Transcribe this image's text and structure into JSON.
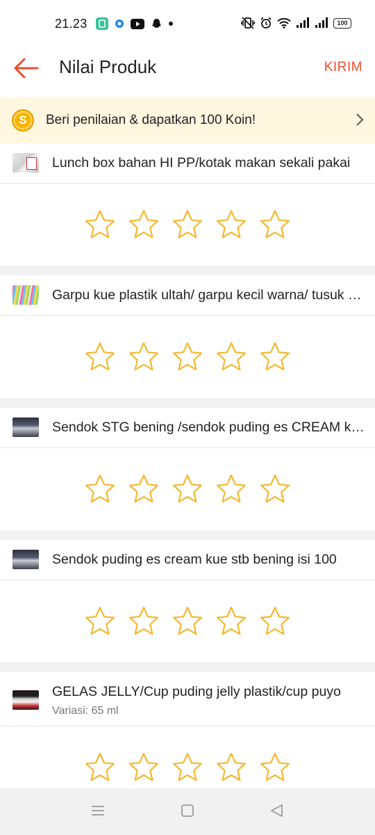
{
  "status": {
    "time": "21.23",
    "battery": "100"
  },
  "header": {
    "title": "Nilai Produk",
    "send_label": "KIRIM"
  },
  "promo": {
    "text": "Beri penilaian & dapatkan 100 Koin!",
    "coin_symbol": "S"
  },
  "products": [
    {
      "name": "Lunch box bahan HI PP/kotak makan sekali pakai",
      "variant": "",
      "rating": 0
    },
    {
      "name": "Garpu kue plastik ultah/ garpu kecil warna/ tusuk buah",
      "variant": "",
      "rating": 0
    },
    {
      "name": "Sendok STG bening /sendok puding es CREAM kue",
      "variant": "",
      "rating": 0
    },
    {
      "name": "Sendok puding es cream kue stb bening isi 100",
      "variant": "",
      "rating": 0
    },
    {
      "name": "GELAS JELLY/Cup puding jelly plastik/cup puyo",
      "variant": "Variasi: 65 ml",
      "rating": 0
    }
  ],
  "colors": {
    "accent": "#ee4d2d",
    "star": "#f5b82e",
    "promo_bg": "#fff7e0"
  },
  "icons": [
    "back-arrow-icon",
    "coin-icon",
    "chevron-right-icon",
    "star-icon",
    "menu-icon",
    "home-icon",
    "back-triangle-icon"
  ]
}
